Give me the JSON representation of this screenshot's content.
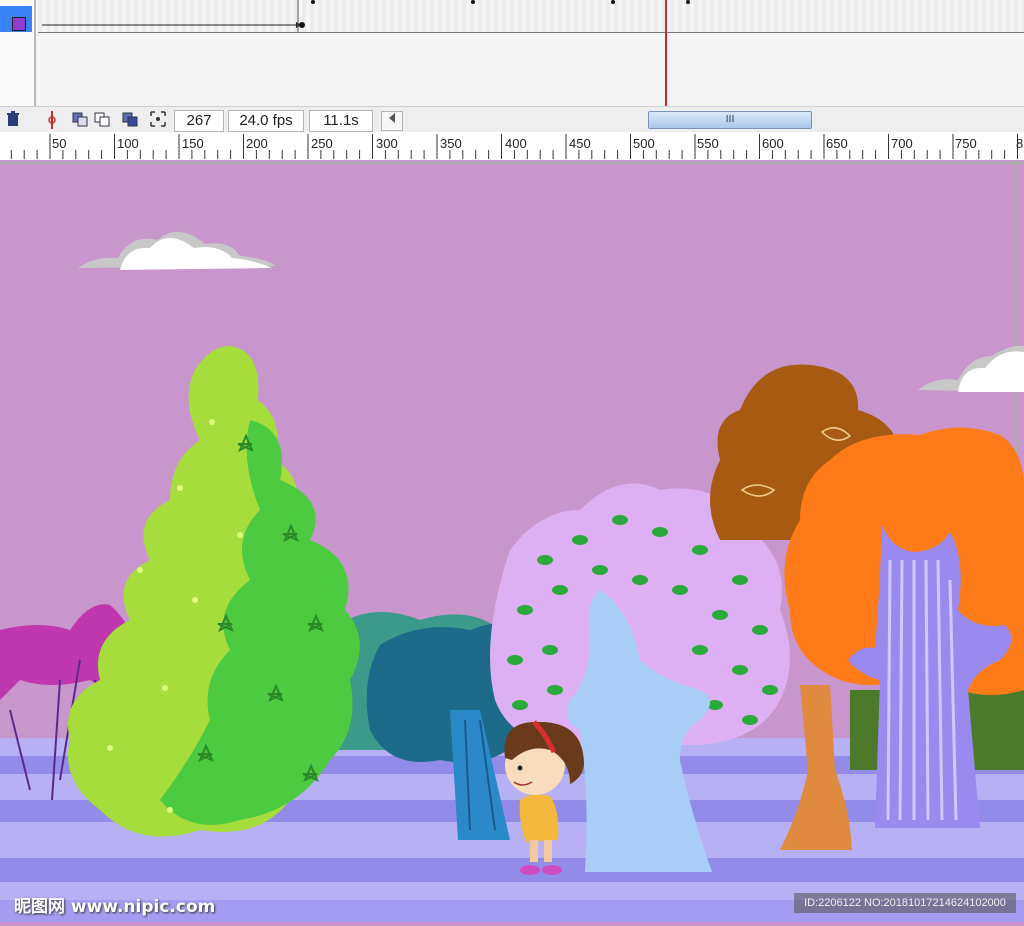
{
  "timeline": {
    "frame": "267",
    "fps": "24.0 fps",
    "elapsed": "11.1s",
    "scroll_thumb": "III"
  },
  "ruler": {
    "ticks": [
      "50",
      "100",
      "150",
      "200",
      "250",
      "300",
      "350",
      "400",
      "450",
      "500",
      "550",
      "600",
      "650",
      "700",
      "750",
      "8"
    ]
  },
  "watermark": {
    "left": "昵图网 www.nipic.com",
    "right": "ID:2206122 NO:20181017214624102000"
  },
  "colors": {
    "sky": "#c896cc",
    "ground_light": "#b8b0f4",
    "ground_dark": "#938be8",
    "playhead": "#cc2a2a",
    "layer_selected": "#3b82f6"
  },
  "icons": [
    "trash-icon",
    "onion-skin-icon",
    "edit-multiple-frames-icon",
    "onion-markers-icon",
    "center-frame-icon",
    "scroll-left-icon"
  ]
}
